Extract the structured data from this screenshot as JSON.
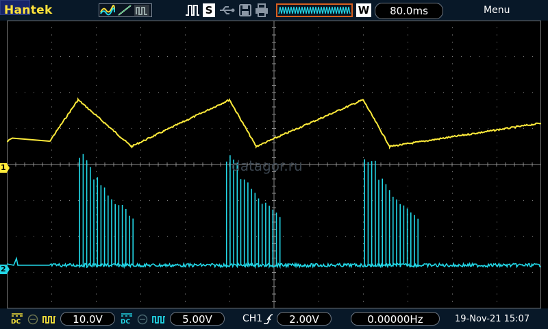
{
  "toolbar": {
    "brand": "Hantek",
    "single_label": "S",
    "wave_label": "W",
    "timebase": "80.0ms",
    "menu_label": "Menu",
    "icons": [
      "wave-select-icons",
      "pulse-trigger-icon",
      "usb-icon",
      "save-disk-icon",
      "printer-icon",
      "memory-waveform-icon"
    ]
  },
  "channels": {
    "ch1": {
      "marker": "1",
      "color": "#ffeb3b",
      "coupling": "DC",
      "volts_div": "10.0V"
    },
    "ch2": {
      "marker": "2",
      "color": "#22d8e8",
      "coupling": "DC",
      "volts_div": "5.00V"
    }
  },
  "trigger": {
    "source": "CH1",
    "slope_icon": "rising-edge-icon",
    "level": "2.00V"
  },
  "frequency": "0.00000Hz",
  "datetime": "19-Nov-21 15:07",
  "watermark": "datagor.ru",
  "colors": {
    "bar": "#081828",
    "grid": "#7a7a7a",
    "ch1": "#ffeb3b",
    "ch2": "#22d8e8",
    "mem_border": "#d86020"
  },
  "waveform": {
    "ch1_shape": "triangle",
    "ch1_peaks_s": [
      0.128,
      0.4,
      0.64
    ],
    "ch1_troughs_s": [
      0.224,
      0.448,
      0.688
    ],
    "ch1_peak_level_div": 1.8,
    "ch1_trough_level_div": 0.5,
    "ch2_shape": "pulse bursts",
    "ch2_burst_starts_s": [
      0.128,
      0.392,
      0.64
    ],
    "ch2_baseline_div": -2.8
  }
}
